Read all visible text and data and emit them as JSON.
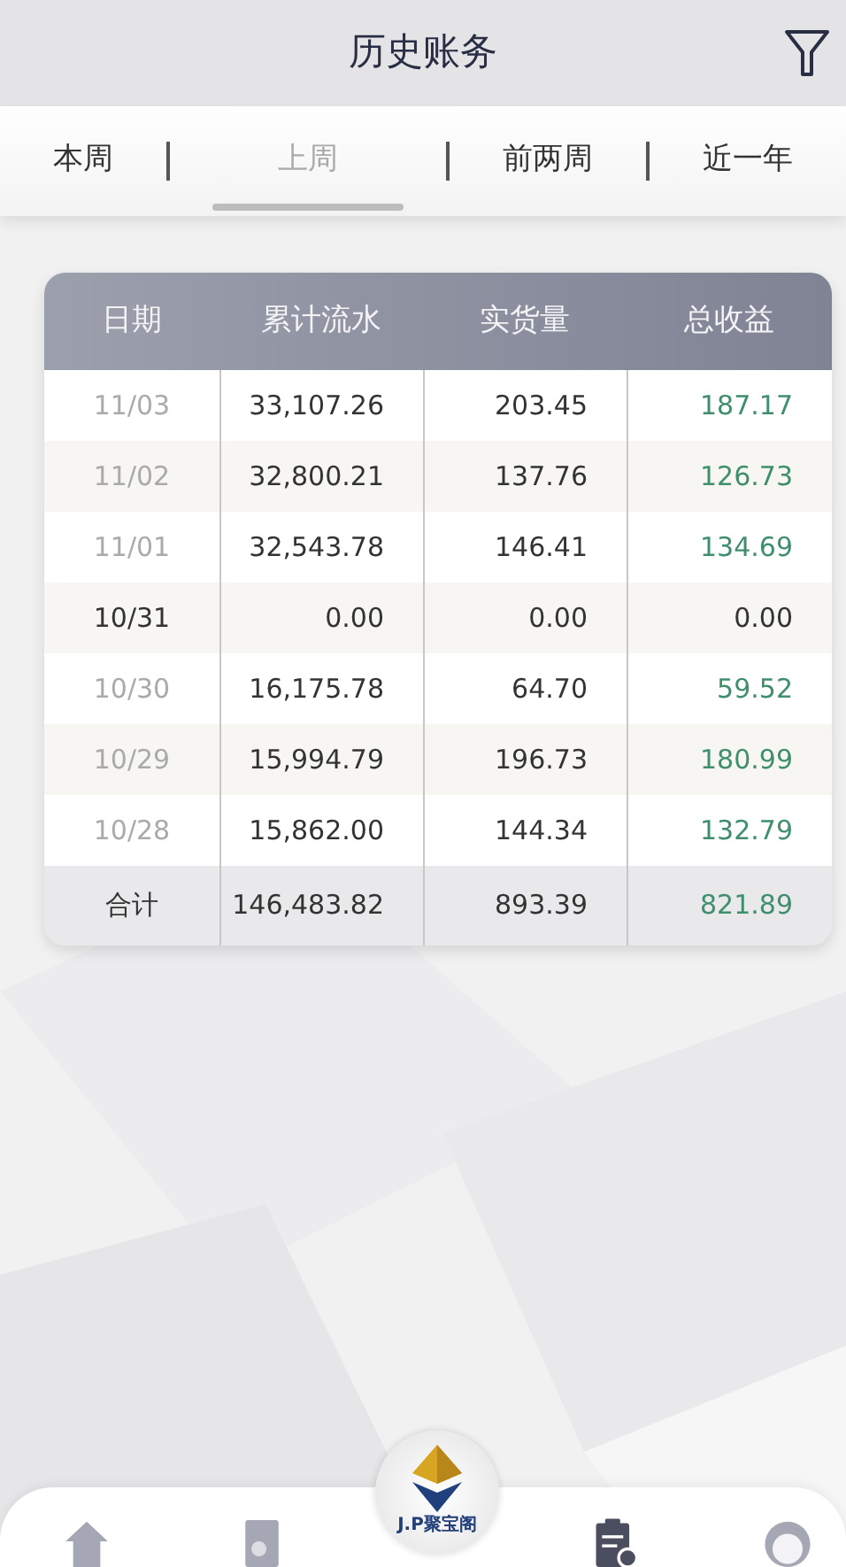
{
  "header": {
    "title": "历史账务"
  },
  "tabs": [
    {
      "label": "本周",
      "selected": false
    },
    {
      "label": "上周",
      "selected": true
    },
    {
      "label": "前两周",
      "selected": false
    },
    {
      "label": "近一年",
      "selected": false
    }
  ],
  "table": {
    "columns": [
      "日期",
      "累计流水",
      "实货量",
      "总收益"
    ],
    "rows": [
      {
        "date": "11/03",
        "flow": "33,107.26",
        "volume": "203.45",
        "earnings": "187.17",
        "highlighted": false,
        "gain": true
      },
      {
        "date": "11/02",
        "flow": "32,800.21",
        "volume": "137.76",
        "earnings": "126.73",
        "highlighted": false,
        "gain": true
      },
      {
        "date": "11/01",
        "flow": "32,543.78",
        "volume": "146.41",
        "earnings": "134.69",
        "highlighted": false,
        "gain": true
      },
      {
        "date": "10/31",
        "flow": "0.00",
        "volume": "0.00",
        "earnings": "0.00",
        "highlighted": true,
        "gain": false
      },
      {
        "date": "10/30",
        "flow": "16,175.78",
        "volume": "64.70",
        "earnings": "59.52",
        "highlighted": false,
        "gain": true
      },
      {
        "date": "10/29",
        "flow": "15,994.79",
        "volume": "196.73",
        "earnings": "180.99",
        "highlighted": false,
        "gain": true
      },
      {
        "date": "10/28",
        "flow": "15,862.00",
        "volume": "144.34",
        "earnings": "132.79",
        "highlighted": false,
        "gain": true
      }
    ],
    "total": {
      "label": "合计",
      "flow": "146,483.82",
      "volume": "893.39",
      "earnings": "821.89",
      "gain": true
    }
  },
  "bottom_nav": {
    "logo_text": "J.P聚宝阁"
  }
}
